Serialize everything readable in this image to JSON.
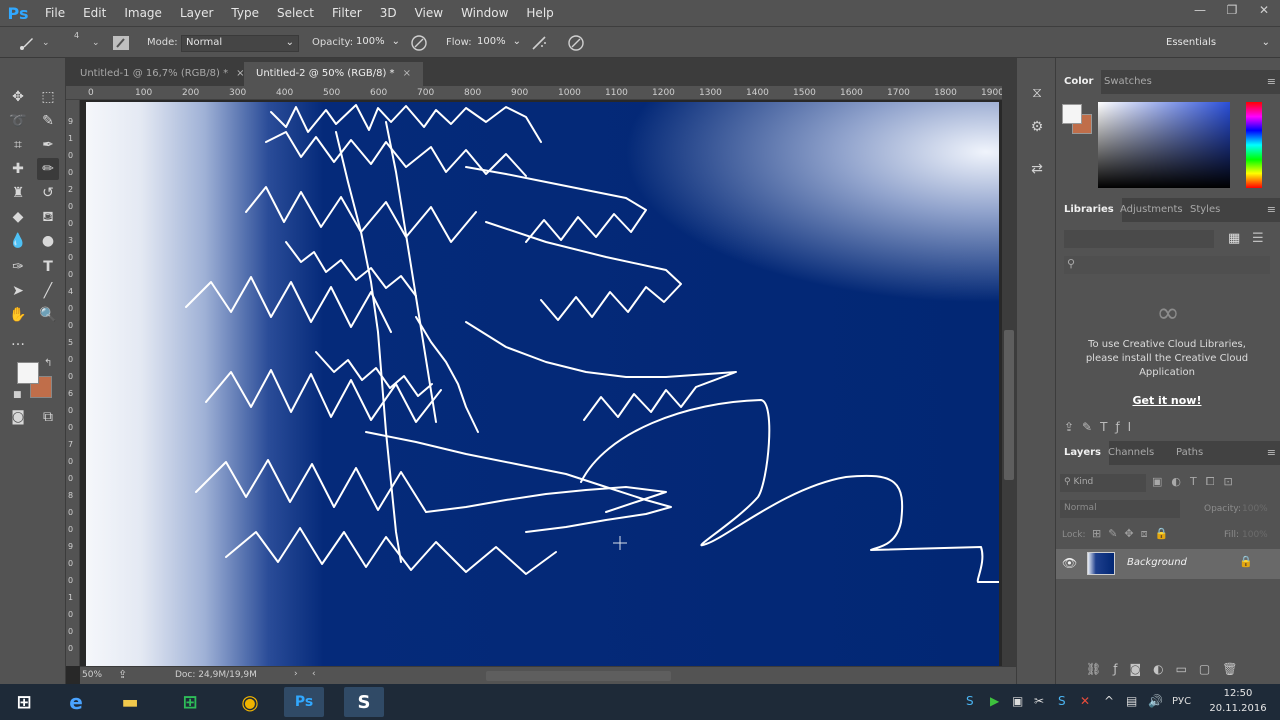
{
  "app": {
    "logo": "Ps"
  },
  "menu": [
    "File",
    "Edit",
    "Image",
    "Layer",
    "Type",
    "Select",
    "Filter",
    "3D",
    "View",
    "Window",
    "Help"
  ],
  "window_controls": {
    "minimize": "—",
    "restore": "❐",
    "close": "✕"
  },
  "options": {
    "mode_label": "Mode:",
    "mode_value": "Normal",
    "opacity_label": "Opacity:",
    "opacity_value": "100%",
    "flow_label": "Flow:",
    "flow_value": "100%",
    "brush_size": "4",
    "workspace_value": "Essentials"
  },
  "tabs": [
    {
      "label": "Untitled-1 @ 16,7% (RGB/8) *",
      "close": "×"
    },
    {
      "label": "Untitled-2 @ 50% (RGB/8) *",
      "close": "×"
    }
  ],
  "ruler_top": [
    "0",
    "100",
    "200",
    "300",
    "400",
    "500",
    "600",
    "700",
    "800",
    "900",
    "1000",
    "1100",
    "1200",
    "1300",
    "1400",
    "1500",
    "1600",
    "1700",
    "1800",
    "1900"
  ],
  "ruler_left": [
    "9",
    "1",
    "0",
    "0",
    "2",
    "0",
    "0",
    "3",
    "0",
    "0",
    "4",
    "0",
    "0",
    "5",
    "0",
    "0",
    "6",
    "0",
    "0",
    "7",
    "0",
    "0",
    "8",
    "0",
    "0",
    "9",
    "0",
    "0",
    "1",
    "0",
    "0",
    "0"
  ],
  "status": {
    "zoom": "50%",
    "doc": "Doc: 24,9M/19,9M"
  },
  "color_panel": {
    "tabs": [
      "Color",
      "Swatches"
    ],
    "fg": "#f5f5f5",
    "bg": "#c06e4a"
  },
  "libraries_panel": {
    "tabs": [
      "Libraries",
      "Adjustments",
      "Styles"
    ],
    "message": "To use Creative Cloud Libraries, please install the Creative Cloud Application",
    "link": "Get it now!"
  },
  "layers_panel": {
    "tabs": [
      "Layers",
      "Channels",
      "Paths"
    ],
    "kind_placeholder": "Kind",
    "blend_mode": "Normal",
    "opacity_label": "Opacity:",
    "opacity_value": "100%",
    "lock_label": "Lock:",
    "fill_label": "Fill:",
    "fill_value": "100%",
    "layers": [
      {
        "name": "Background",
        "visible": true,
        "locked": true
      }
    ]
  },
  "taskbar": {
    "lang": "РУС",
    "time": "12:50",
    "date": "20.11.2016"
  },
  "colors": {
    "canvas_navy": "#022774",
    "ui_panel": "#535353",
    "ps_blue": "#31a8ff"
  }
}
